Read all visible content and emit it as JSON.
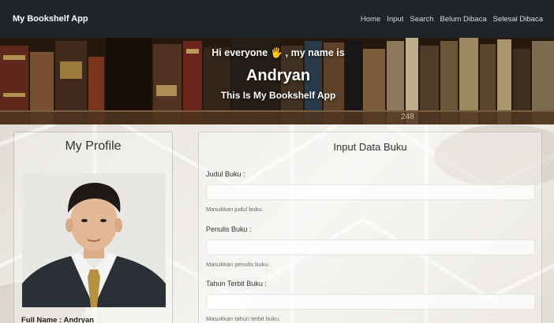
{
  "navbar": {
    "brand": "My Bookshelf App",
    "links": [
      "Home",
      "Input",
      "Search",
      "Belum Dibaca",
      "Selesai Dibaca"
    ]
  },
  "hero": {
    "greeting": "Hi everyone 🖐 , my name is",
    "name": "Andryan",
    "subtitle": "This Is My Bookshelf App",
    "shelf_label": "248"
  },
  "profile": {
    "title": "My Profile",
    "full_name_label": "Full Name : ",
    "full_name": "Andryan"
  },
  "input_form": {
    "title": "Input Data Buku",
    "fields": [
      {
        "label": "Judul Buku :",
        "value": "",
        "help": "Masukkan judul buku."
      },
      {
        "label": "Penulis Buku :",
        "value": "",
        "help": "Masukkan penulis buku."
      },
      {
        "label": "Tahun Terbit Buku :",
        "value": "",
        "help": "Masukkan tahun terbit buku."
      }
    ]
  },
  "colors": {
    "navbar_bg": "#212529",
    "nav_text": "#d7dbe0",
    "hero_text": "#ffffff"
  }
}
